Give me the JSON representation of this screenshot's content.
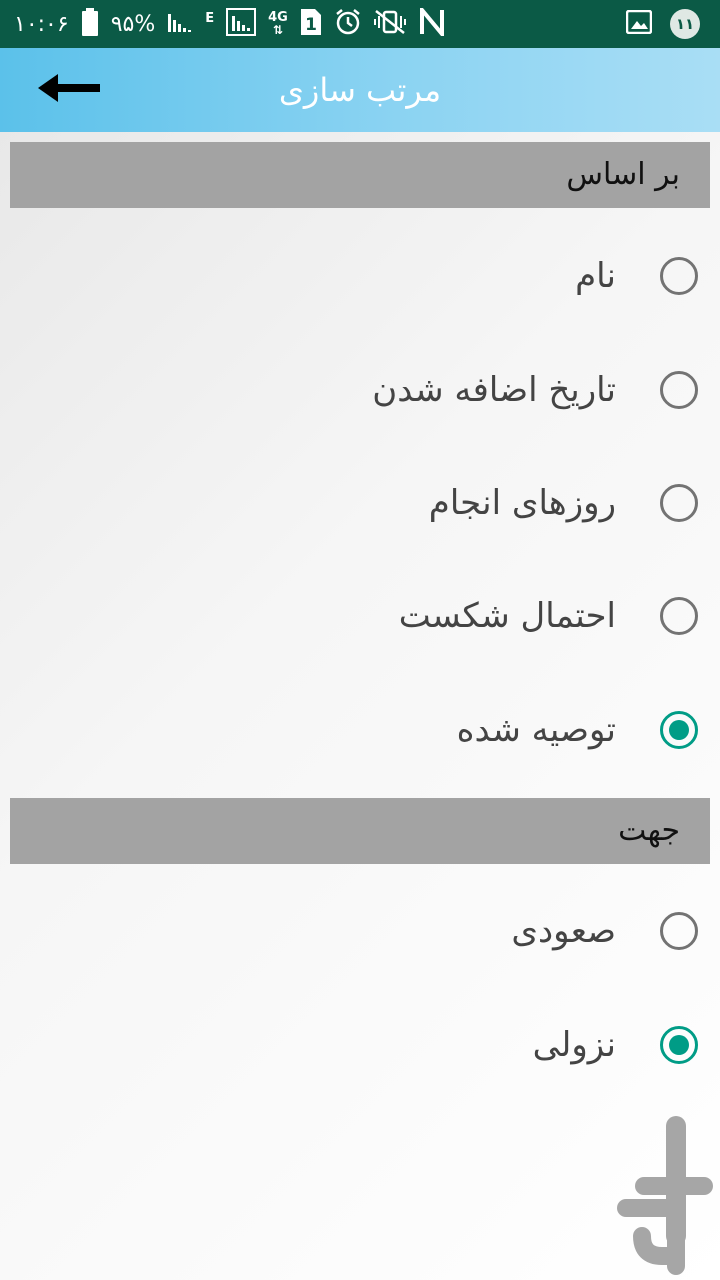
{
  "status_bar": {
    "time": "۱۰:۰۶",
    "battery": "۹۵%",
    "notification_count": "۱۱",
    "network_label": "4G",
    "sim_label": "1",
    "edge_label": "E"
  },
  "app_bar": {
    "title": "مرتب سازی",
    "back_icon": "arrow-left-icon"
  },
  "sort_by": {
    "header": "بر اساس",
    "options": [
      {
        "label": "نام",
        "checked": false
      },
      {
        "label": "تاریخ اضافه شدن",
        "checked": false
      },
      {
        "label": "روزهای انجام",
        "checked": false
      },
      {
        "label": "احتمال شکست",
        "checked": false
      },
      {
        "label": "توصیه شده",
        "checked": true
      }
    ]
  },
  "direction": {
    "header": "جهت",
    "options": [
      {
        "label": "صعودی",
        "checked": false
      },
      {
        "label": "نزولی",
        "checked": true
      }
    ]
  },
  "colors": {
    "status_bar": "#0b5a46",
    "app_bar": "#5bc1ea",
    "accent": "#009c86",
    "section_header": "#a3a3a3"
  }
}
